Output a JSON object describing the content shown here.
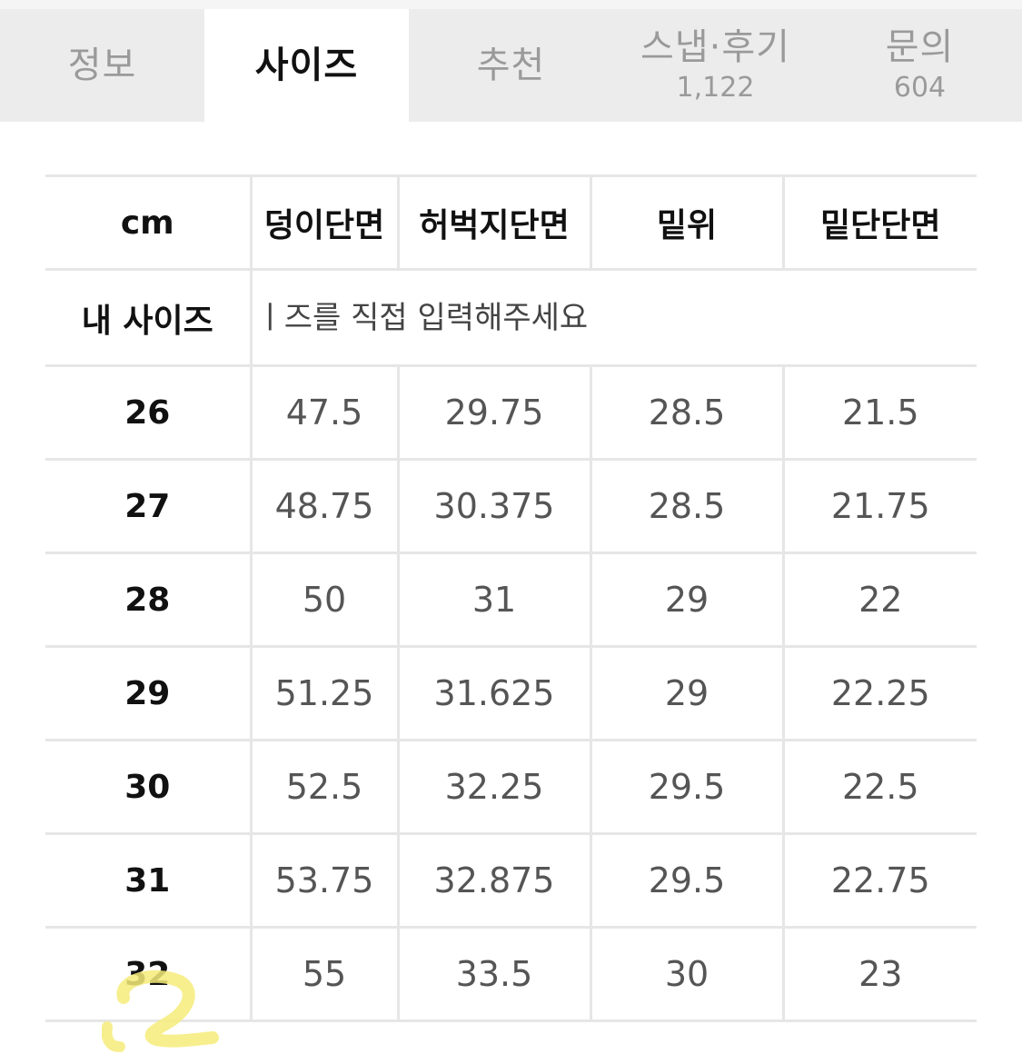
{
  "tabs": [
    {
      "label": "정보",
      "count": "",
      "active": false
    },
    {
      "label": "사이즈",
      "count": "",
      "active": true
    },
    {
      "label": "추천",
      "count": "",
      "active": false
    },
    {
      "label": "스냅·후기",
      "count": "1,122",
      "active": false
    },
    {
      "label": "문의",
      "count": "604",
      "active": false
    }
  ],
  "table": {
    "unit": "cm",
    "columns": [
      "덩이단면",
      "허벅지단면",
      "밑위",
      "밑단단면"
    ],
    "my_size": {
      "label": "내 사이즈",
      "placeholder": "ㅣ즈를 직접 입력해주세요",
      "value": ""
    },
    "rows": [
      {
        "size": "26",
        "values": [
          "47.5",
          "29.75",
          "28.5",
          "21.5"
        ]
      },
      {
        "size": "27",
        "values": [
          "48.75",
          "30.375",
          "28.5",
          "21.75"
        ]
      },
      {
        "size": "28",
        "values": [
          "50",
          "31",
          "29",
          "22"
        ]
      },
      {
        "size": "29",
        "values": [
          "51.25",
          "31.625",
          "29",
          "22.25"
        ]
      },
      {
        "size": "30",
        "values": [
          "52.5",
          "32.25",
          "29.5",
          "22.5"
        ]
      },
      {
        "size": "31",
        "values": [
          "53.75",
          "32.875",
          "29.5",
          "22.75"
        ]
      },
      {
        "size": "32",
        "values": [
          "55",
          "33.5",
          "30",
          "23"
        ]
      }
    ]
  },
  "colors": {
    "tab_bg": "#ececec",
    "tab_active_bg": "#ffffff",
    "tab_inactive_text": "#9a9a9a",
    "grid_line": "#e6e6e6",
    "highlight": "#f6ec7a"
  }
}
